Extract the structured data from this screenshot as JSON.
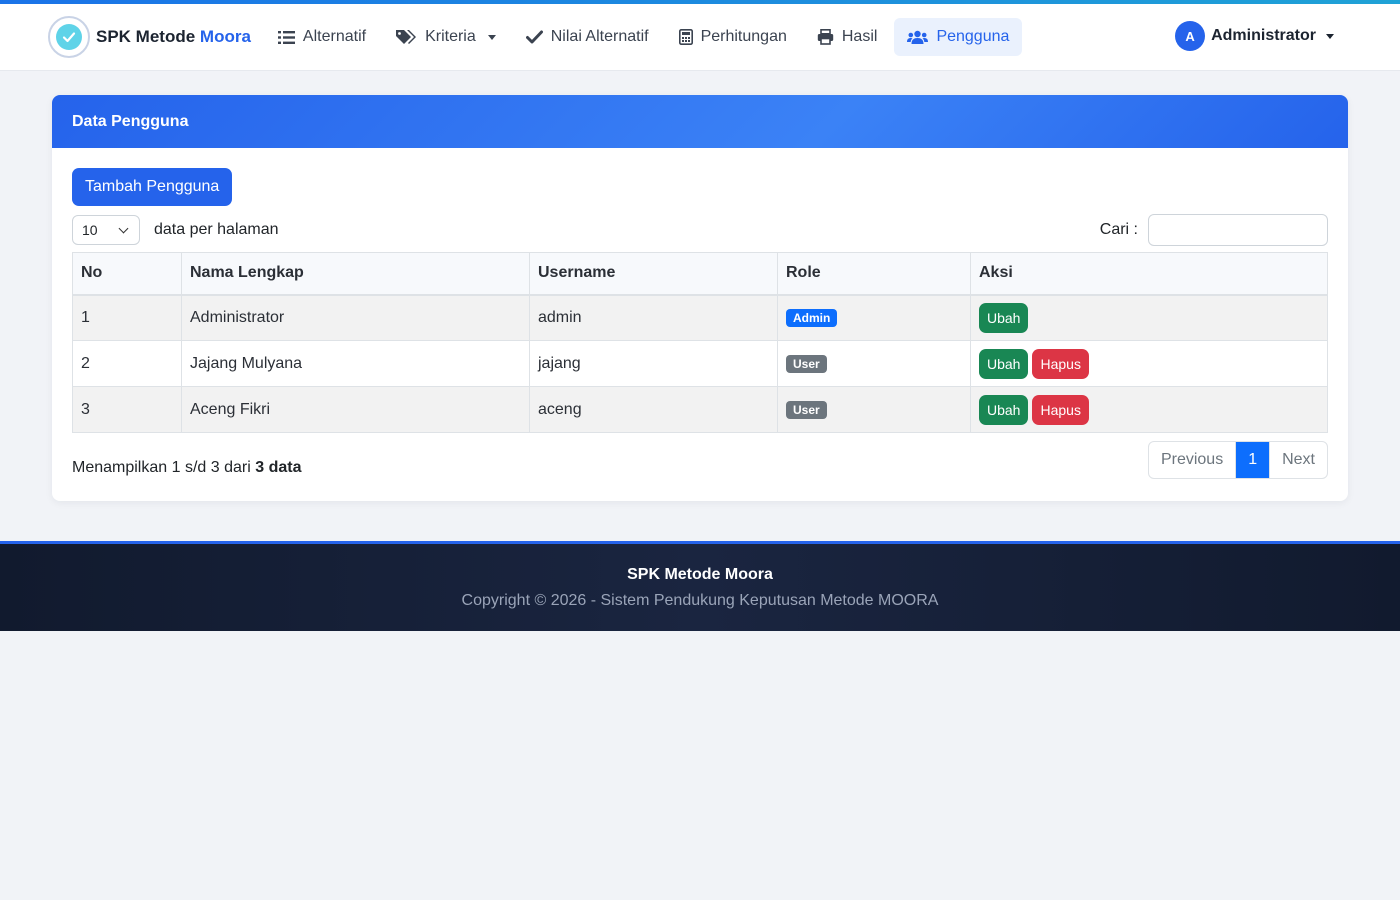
{
  "brand": {
    "name": "SPK Metode",
    "accent": "Moora"
  },
  "nav": [
    {
      "label": "Alternatif",
      "icon": "list-icon"
    },
    {
      "label": "Kriteria",
      "icon": "tags-icon"
    },
    {
      "label": "Nilai Alternatif",
      "icon": "check-icon"
    },
    {
      "label": "Perhitungan",
      "icon": "calculator-icon"
    },
    {
      "label": "Hasil",
      "icon": "print-icon"
    },
    {
      "label": "Pengguna",
      "icon": "users-icon"
    }
  ],
  "user": {
    "initial": "A",
    "name": "Administrator"
  },
  "card": {
    "title": "Data Pengguna",
    "add_button": "Tambah Pengguna",
    "length_value": "10",
    "length_label": "data per halaman",
    "search_label": "Cari :"
  },
  "table": {
    "headers": [
      "No",
      "Nama Lengkap",
      "Username",
      "Role",
      "Aksi"
    ],
    "rows": [
      {
        "no": "1",
        "name": "Administrator",
        "username": "admin",
        "role": "Admin",
        "edit": "Ubah"
      },
      {
        "no": "2",
        "name": "Jajang Mulyana",
        "username": "jajang",
        "role": "User",
        "edit": "Ubah",
        "delete": "Hapus"
      },
      {
        "no": "3",
        "name": "Aceng Fikri",
        "username": "aceng",
        "role": "User",
        "edit": "Ubah",
        "delete": "Hapus"
      }
    ]
  },
  "info": {
    "prefix": "Menampilkan 1 s/d 3 dari",
    "bold": "3 data"
  },
  "pagination": {
    "previous": "Previous",
    "current": "1",
    "next": "Next"
  },
  "footer": {
    "title": "SPK Metode Moora",
    "copyright": "Copyright © 2026 - Sistem Pendukung Keputusan Metode MOORA"
  }
}
